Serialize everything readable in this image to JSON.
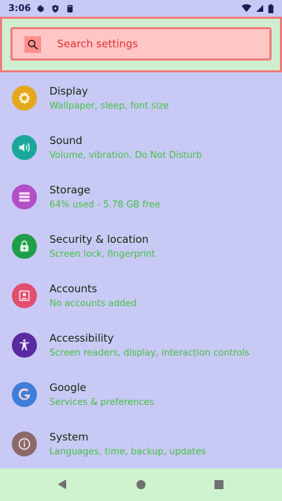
{
  "status_bar": {
    "time": "3:06",
    "left_icons": [
      "settings-gear-icon",
      "shield-icon",
      "sd-card-icon"
    ],
    "right_icons": [
      "wifi-icon",
      "cellular-icon",
      "battery-icon"
    ]
  },
  "search": {
    "placeholder": "Search settings",
    "icon": "search-icon"
  },
  "settings": [
    {
      "id": "display",
      "title": "Display",
      "subtitle": "Wallpaper, sleep, font size",
      "icon": "display-icon",
      "color": "#e5a81d"
    },
    {
      "id": "sound",
      "title": "Sound",
      "subtitle": "Volume, vibration, Do Not Disturb",
      "icon": "sound-icon",
      "color": "#1aa79a"
    },
    {
      "id": "storage",
      "title": "Storage",
      "subtitle": "64% used - 5.78 GB free",
      "icon": "storage-icon",
      "color": "#b24ec6"
    },
    {
      "id": "security",
      "title": "Security & location",
      "subtitle": "Screen lock, fingerprint",
      "icon": "lock-icon",
      "color": "#1f9e4a"
    },
    {
      "id": "accounts",
      "title": "Accounts",
      "subtitle": "No accounts added",
      "icon": "accounts-icon",
      "color": "#e24e6e"
    },
    {
      "id": "accessibility",
      "title": "Accessibility",
      "subtitle": "Screen readers, display, interaction controls",
      "icon": "accessibility-icon",
      "color": "#5a2aa0"
    },
    {
      "id": "google",
      "title": "Google",
      "subtitle": "Services & preferences",
      "icon": "google-icon",
      "color": "#3f7ed9"
    },
    {
      "id": "system",
      "title": "System",
      "subtitle": "Languages, time, backup, updates",
      "icon": "info-icon",
      "color": "#8a6a6a"
    }
  ],
  "nav_bar": {
    "buttons": [
      "back-icon",
      "home-icon",
      "recents-icon"
    ]
  }
}
